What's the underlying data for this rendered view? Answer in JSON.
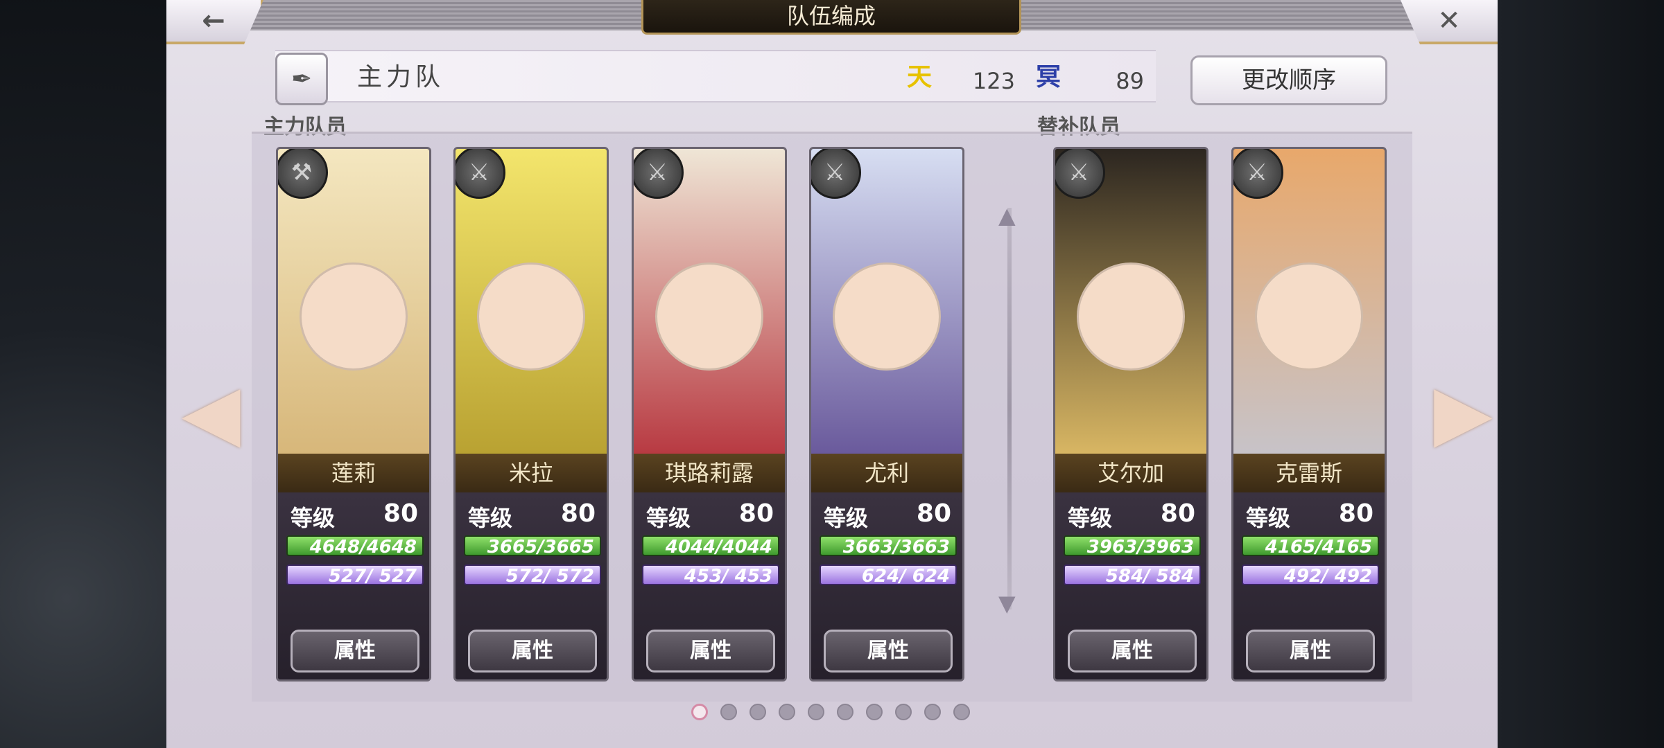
{
  "header": {
    "title": "队伍编成"
  },
  "team": {
    "name": "主力队",
    "reorder_label": "更改顺序"
  },
  "currency": [
    {
      "icon": "天",
      "value": "123",
      "color": "#e7c200"
    },
    {
      "icon": "冥",
      "value": "89",
      "color": "#2d3fa8"
    }
  ],
  "sections": {
    "main": "主力队员",
    "reserve": "替补队员"
  },
  "level_label": "等级",
  "attr_label": "属性",
  "main_members": [
    {
      "name": "莲莉",
      "level": "80",
      "hp": "4648/4648",
      "mp": "527/ 527",
      "weapon": "axe-icon"
    },
    {
      "name": "米拉",
      "level": "80",
      "hp": "3665/3665",
      "mp": "572/ 572",
      "weapon": "sword-icon"
    },
    {
      "name": "琪路莉露",
      "level": "80",
      "hp": "4044/4044",
      "mp": "453/ 453",
      "weapon": "sword-icon"
    },
    {
      "name": "尤利",
      "level": "80",
      "hp": "3663/3663",
      "mp": "624/ 624",
      "weapon": "sword-icon"
    }
  ],
  "reserve_members": [
    {
      "name": "艾尔加",
      "level": "80",
      "hp": "3963/3963",
      "mp": "584/ 584",
      "weapon": "sword-icon"
    },
    {
      "name": "克雷斯",
      "level": "80",
      "hp": "4165/4165",
      "mp": "492/ 492",
      "weapon": "sword-icon"
    }
  ],
  "pagination": {
    "total": 10,
    "current": 1
  }
}
